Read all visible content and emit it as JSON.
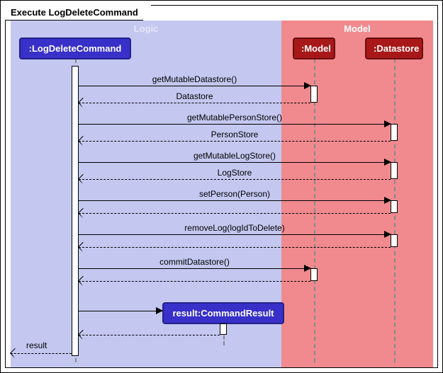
{
  "frame": {
    "title": "Execute LogDeleteCommand"
  },
  "regions": {
    "logic": "Logic",
    "model": "Model"
  },
  "participants": {
    "logdelete": ":LogDeleteCommand",
    "model": ":Model",
    "datastore": ":Datastore",
    "result": "result:CommandResult"
  },
  "messages": {
    "m1": "getMutableDatastore()",
    "r1": "Datastore",
    "m2": "getMutablePersonStore()",
    "r2": "PersonStore",
    "m3": "getMutableLogStore()",
    "r3": "LogStore",
    "m4": "setPerson(Person)",
    "r4": "",
    "m5": "removeLog(logIdToDelete)",
    "r5": "",
    "m6": "commitDatastore()",
    "r6": "",
    "r7": "",
    "final": "result"
  },
  "chart_data": {
    "type": "sequence-diagram",
    "frame": "Execute LogDeleteCommand",
    "participants": [
      {
        "name": ":LogDeleteCommand",
        "group": "Logic"
      },
      {
        "name": ":Model",
        "group": "Model"
      },
      {
        "name": ":Datastore",
        "group": "Model"
      },
      {
        "name": "result:CommandResult",
        "group": "Logic",
        "created_by_message": 13
      }
    ],
    "groups": [
      "Logic",
      "Model"
    ],
    "messages": [
      {
        "from": ":LogDeleteCommand",
        "to": ":Model",
        "label": "getMutableDatastore()",
        "kind": "sync"
      },
      {
        "from": ":Model",
        "to": ":LogDeleteCommand",
        "label": "Datastore",
        "kind": "return"
      },
      {
        "from": ":LogDeleteCommand",
        "to": ":Datastore",
        "label": "getMutablePersonStore()",
        "kind": "sync"
      },
      {
        "from": ":Datastore",
        "to": ":LogDeleteCommand",
        "label": "PersonStore",
        "kind": "return"
      },
      {
        "from": ":LogDeleteCommand",
        "to": ":Datastore",
        "label": "getMutableLogStore()",
        "kind": "sync"
      },
      {
        "from": ":Datastore",
        "to": ":LogDeleteCommand",
        "label": "LogStore",
        "kind": "return"
      },
      {
        "from": ":LogDeleteCommand",
        "to": ":Datastore",
        "label": "setPerson(Person)",
        "kind": "sync"
      },
      {
        "from": ":Datastore",
        "to": ":LogDeleteCommand",
        "label": "",
        "kind": "return"
      },
      {
        "from": ":LogDeleteCommand",
        "to": ":Datastore",
        "label": "removeLog(logIdToDelete)",
        "kind": "sync"
      },
      {
        "from": ":Datastore",
        "to": ":LogDeleteCommand",
        "label": "",
        "kind": "return"
      },
      {
        "from": ":LogDeleteCommand",
        "to": ":Model",
        "label": "commitDatastore()",
        "kind": "sync"
      },
      {
        "from": ":Model",
        "to": ":LogDeleteCommand",
        "label": "",
        "kind": "return"
      },
      {
        "from": ":LogDeleteCommand",
        "to": "result:CommandResult",
        "label": "",
        "kind": "create"
      },
      {
        "from": "result:CommandResult",
        "to": ":LogDeleteCommand",
        "label": "",
        "kind": "return"
      },
      {
        "from": ":LogDeleteCommand",
        "to": "caller",
        "label": "result",
        "kind": "return"
      }
    ]
  }
}
